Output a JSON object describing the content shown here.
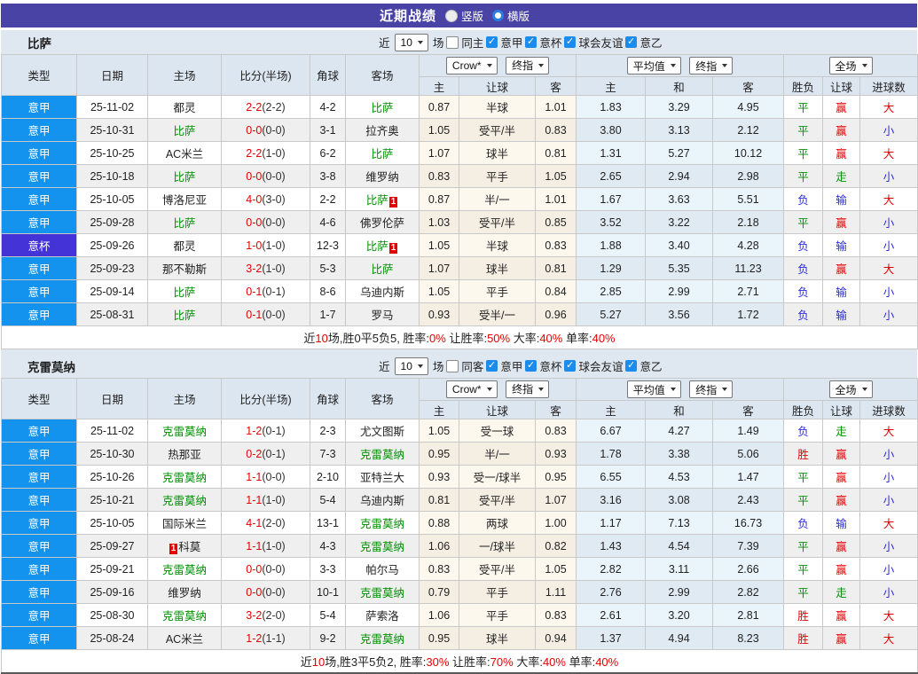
{
  "titlebar": {
    "title": "近期战绩",
    "radios": [
      {
        "label": "竖版",
        "selected": false
      },
      {
        "label": "横版",
        "selected": true
      }
    ]
  },
  "labels": {
    "near": "近",
    "games": "场",
    "leagues": [
      "意甲",
      "意杯",
      "球会友谊",
      "意乙"
    ]
  },
  "selects": {
    "crown": "Crow*",
    "final": "终指",
    "average": "平均值",
    "final2": "终指",
    "full": "全场"
  },
  "columns": {
    "type": "类型",
    "date": "日期",
    "home": "主场",
    "score": "比分(半场)",
    "corner": "角球",
    "away": "客场",
    "odds_home": "主",
    "odds_handicap": "让球",
    "odds_away": "客",
    "avg_home": "主",
    "avg_draw": "和",
    "avg_away": "客",
    "res_wdl": "胜负",
    "res_handicap": "让球",
    "res_goals": "进球数"
  },
  "row_fields": [
    "league",
    "league_class(a=意甲,b=意杯)",
    "date",
    "home[name,isSelf,badge,badgePos]",
    "score[full,half]",
    "corner",
    "away[name,isSelf,badge,badgePos]",
    "crown_home",
    "crown_handicap",
    "crown_away",
    "avg_home",
    "avg_draw",
    "avg_away",
    "result_wdl[text,color]",
    "result_handicap[text,color]",
    "result_goals[text,color]"
  ],
  "tables": [
    {
      "team": "比萨",
      "count": "10",
      "same_side": "同主",
      "same_checked": false,
      "rows": [
        [
          "意甲",
          "a",
          "25-11-02",
          [
            "都灵",
            0,
            "",
            ""
          ],
          [
            "2-2",
            "(2-2)"
          ],
          "4-2",
          [
            "比萨",
            1,
            "",
            ""
          ],
          "0.87",
          "半球",
          "1.01",
          "1.83",
          "3.29",
          "4.95",
          [
            "平",
            "g"
          ],
          [
            "赢",
            "r"
          ],
          [
            "大",
            "r"
          ]
        ],
        [
          "意甲",
          "a",
          "25-10-31",
          [
            "比萨",
            1,
            "",
            ""
          ],
          [
            "0-0",
            "(0-0)"
          ],
          "3-1",
          [
            "拉齐奥",
            0,
            "",
            ""
          ],
          "1.05",
          "受平/半",
          "0.83",
          "3.80",
          "3.13",
          "2.12",
          [
            "平",
            "g"
          ],
          [
            "赢",
            "r"
          ],
          [
            "小",
            "b"
          ]
        ],
        [
          "意甲",
          "a",
          "25-10-25",
          [
            "AC米兰",
            0,
            "",
            ""
          ],
          [
            "2-2",
            "(1-0)"
          ],
          "6-2",
          [
            "比萨",
            1,
            "",
            ""
          ],
          "1.07",
          "球半",
          "0.81",
          "1.31",
          "5.27",
          "10.12",
          [
            "平",
            "g"
          ],
          [
            "赢",
            "r"
          ],
          [
            "大",
            "r"
          ]
        ],
        [
          "意甲",
          "a",
          "25-10-18",
          [
            "比萨",
            1,
            "",
            ""
          ],
          [
            "0-0",
            "(0-0)"
          ],
          "3-8",
          [
            "维罗纳",
            0,
            "",
            ""
          ],
          "0.83",
          "平手",
          "1.05",
          "2.65",
          "2.94",
          "2.98",
          [
            "平",
            "g"
          ],
          [
            "走",
            "g"
          ],
          [
            "小",
            "b"
          ]
        ],
        [
          "意甲",
          "a",
          "25-10-05",
          [
            "博洛尼亚",
            0,
            "",
            ""
          ],
          [
            "4-0",
            "(3-0)"
          ],
          "2-2",
          [
            "比萨",
            1,
            "1",
            "a"
          ],
          "0.87",
          "半/一",
          "1.01",
          "1.67",
          "3.63",
          "5.51",
          [
            "负",
            "b"
          ],
          [
            "输",
            "b"
          ],
          [
            "大",
            "r"
          ]
        ],
        [
          "意甲",
          "a",
          "25-09-28",
          [
            "比萨",
            1,
            "",
            ""
          ],
          [
            "0-0",
            "(0-0)"
          ],
          "4-6",
          [
            "佛罗伦萨",
            0,
            "",
            ""
          ],
          "1.03",
          "受平/半",
          "0.85",
          "3.52",
          "3.22",
          "2.18",
          [
            "平",
            "g"
          ],
          [
            "赢",
            "r"
          ],
          [
            "小",
            "b"
          ]
        ],
        [
          "意杯",
          "b",
          "25-09-26",
          [
            "都灵",
            0,
            "",
            ""
          ],
          [
            "1-0",
            "(1-0)"
          ],
          "12-3",
          [
            "比萨",
            1,
            "1",
            "a"
          ],
          "1.05",
          "半球",
          "0.83",
          "1.88",
          "3.40",
          "4.28",
          [
            "负",
            "b"
          ],
          [
            "输",
            "b"
          ],
          [
            "小",
            "b"
          ]
        ],
        [
          "意甲",
          "a",
          "25-09-23",
          [
            "那不勒斯",
            0,
            "",
            ""
          ],
          [
            "3-2",
            "(1-0)"
          ],
          "5-3",
          [
            "比萨",
            1,
            "",
            ""
          ],
          "1.07",
          "球半",
          "0.81",
          "1.29",
          "5.35",
          "11.23",
          [
            "负",
            "b"
          ],
          [
            "赢",
            "r"
          ],
          [
            "大",
            "r"
          ]
        ],
        [
          "意甲",
          "a",
          "25-09-14",
          [
            "比萨",
            1,
            "",
            ""
          ],
          [
            "0-1",
            "(0-1)"
          ],
          "8-6",
          [
            "乌迪内斯",
            0,
            "",
            ""
          ],
          "1.05",
          "平手",
          "0.84",
          "2.85",
          "2.99",
          "2.71",
          [
            "负",
            "b"
          ],
          [
            "输",
            "b"
          ],
          [
            "小",
            "b"
          ]
        ],
        [
          "意甲",
          "a",
          "25-08-31",
          [
            "比萨",
            1,
            "",
            ""
          ],
          [
            "0-1",
            "(0-0)"
          ],
          "1-7",
          [
            "罗马",
            0,
            "",
            ""
          ],
          "0.93",
          "受半/一",
          "0.96",
          "5.27",
          "3.56",
          "1.72",
          [
            "负",
            "b"
          ],
          [
            "输",
            "b"
          ],
          [
            "小",
            "b"
          ]
        ]
      ],
      "summary": [
        [
          "近",
          0
        ],
        [
          "10",
          1
        ],
        [
          "场,胜0平5负5, 胜率:",
          0
        ],
        [
          "0%",
          1
        ],
        [
          " 让胜率:",
          0
        ],
        [
          "50%",
          1
        ],
        [
          " 大率:",
          0
        ],
        [
          "40%",
          1
        ],
        [
          " 单率:",
          0
        ],
        [
          "40%",
          1
        ]
      ]
    },
    {
      "team": "克雷莫纳",
      "count": "10",
      "same_side": "同客",
      "same_checked": false,
      "rows": [
        [
          "意甲",
          "a",
          "25-11-02",
          [
            "克雷莫纳",
            1,
            "",
            ""
          ],
          [
            "1-2",
            "(0-1)"
          ],
          "2-3",
          [
            "尤文图斯",
            0,
            "",
            ""
          ],
          "1.05",
          "受一球",
          "0.83",
          "6.67",
          "4.27",
          "1.49",
          [
            "负",
            "b"
          ],
          [
            "走",
            "g"
          ],
          [
            "大",
            "r"
          ]
        ],
        [
          "意甲",
          "a",
          "25-10-30",
          [
            "热那亚",
            0,
            "",
            ""
          ],
          [
            "0-2",
            "(0-1)"
          ],
          "7-3",
          [
            "克雷莫纳",
            1,
            "",
            ""
          ],
          "0.95",
          "半/一",
          "0.93",
          "1.78",
          "3.38",
          "5.06",
          [
            "胜",
            "r"
          ],
          [
            "赢",
            "r"
          ],
          [
            "小",
            "b"
          ]
        ],
        [
          "意甲",
          "a",
          "25-10-26",
          [
            "克雷莫纳",
            1,
            "",
            ""
          ],
          [
            "1-1",
            "(0-0)"
          ],
          "2-10",
          [
            "亚特兰大",
            0,
            "",
            ""
          ],
          "0.93",
          "受一/球半",
          "0.95",
          "6.55",
          "4.53",
          "1.47",
          [
            "平",
            "g"
          ],
          [
            "赢",
            "r"
          ],
          [
            "小",
            "b"
          ]
        ],
        [
          "意甲",
          "a",
          "25-10-21",
          [
            "克雷莫纳",
            1,
            "",
            ""
          ],
          [
            "1-1",
            "(1-0)"
          ],
          "5-4",
          [
            "乌迪内斯",
            0,
            "",
            ""
          ],
          "0.81",
          "受平/半",
          "1.07",
          "3.16",
          "3.08",
          "2.43",
          [
            "平",
            "g"
          ],
          [
            "赢",
            "r"
          ],
          [
            "小",
            "b"
          ]
        ],
        [
          "意甲",
          "a",
          "25-10-05",
          [
            "国际米兰",
            0,
            "",
            ""
          ],
          [
            "4-1",
            "(2-0)"
          ],
          "13-1",
          [
            "克雷莫纳",
            1,
            "",
            ""
          ],
          "0.88",
          "两球",
          "1.00",
          "1.17",
          "7.13",
          "16.73",
          [
            "负",
            "b"
          ],
          [
            "输",
            "b"
          ],
          [
            "大",
            "r"
          ]
        ],
        [
          "意甲",
          "a",
          "25-09-27",
          [
            "科莫",
            0,
            "1",
            "b"
          ],
          [
            "1-1",
            "(1-0)"
          ],
          "4-3",
          [
            "克雷莫纳",
            1,
            "",
            ""
          ],
          "1.06",
          "一/球半",
          "0.82",
          "1.43",
          "4.54",
          "7.39",
          [
            "平",
            "g"
          ],
          [
            "赢",
            "r"
          ],
          [
            "小",
            "b"
          ]
        ],
        [
          "意甲",
          "a",
          "25-09-21",
          [
            "克雷莫纳",
            1,
            "",
            ""
          ],
          [
            "0-0",
            "(0-0)"
          ],
          "3-3",
          [
            "帕尔马",
            0,
            "",
            ""
          ],
          "0.83",
          "受平/半",
          "1.05",
          "2.82",
          "3.11",
          "2.66",
          [
            "平",
            "g"
          ],
          [
            "赢",
            "r"
          ],
          [
            "小",
            "b"
          ]
        ],
        [
          "意甲",
          "a",
          "25-09-16",
          [
            "维罗纳",
            0,
            "",
            ""
          ],
          [
            "0-0",
            "(0-0)"
          ],
          "10-1",
          [
            "克雷莫纳",
            1,
            "",
            ""
          ],
          "0.79",
          "平手",
          "1.11",
          "2.76",
          "2.99",
          "2.82",
          [
            "平",
            "g"
          ],
          [
            "走",
            "g"
          ],
          [
            "小",
            "b"
          ]
        ],
        [
          "意甲",
          "a",
          "25-08-30",
          [
            "克雷莫纳",
            1,
            "",
            ""
          ],
          [
            "3-2",
            "(2-0)"
          ],
          "5-4",
          [
            "萨索洛",
            0,
            "",
            ""
          ],
          "1.06",
          "平手",
          "0.83",
          "2.61",
          "3.20",
          "2.81",
          [
            "胜",
            "r"
          ],
          [
            "赢",
            "r"
          ],
          [
            "大",
            "r"
          ]
        ],
        [
          "意甲",
          "a",
          "25-08-24",
          [
            "AC米兰",
            0,
            "",
            ""
          ],
          [
            "1-2",
            "(1-1)"
          ],
          "9-2",
          [
            "克雷莫纳",
            1,
            "",
            ""
          ],
          "0.95",
          "球半",
          "0.94",
          "1.37",
          "4.94",
          "8.23",
          [
            "胜",
            "r"
          ],
          [
            "赢",
            "r"
          ],
          [
            "大",
            "r"
          ]
        ]
      ],
      "summary": [
        [
          "近",
          0
        ],
        [
          "10",
          1
        ],
        [
          "场,胜3平5负2, 胜率:",
          0
        ],
        [
          "30%",
          1
        ],
        [
          " 让胜率:",
          0
        ],
        [
          "70%",
          1
        ],
        [
          " 大率:",
          0
        ],
        [
          "40%",
          1
        ],
        [
          " 单率:",
          0
        ],
        [
          "40%",
          1
        ]
      ]
    }
  ],
  "colors": {
    "topbar_bg": "#4a43a6",
    "band_bg": "#dfe7f1",
    "header_cell_bg": "#dce6f1",
    "serie_a_bg": "#1493ee",
    "coppa_bg": "#4433d6",
    "team_green": "#009000",
    "score_red": "#e60000",
    "result_red": "#e60000",
    "result_green": "#009000",
    "result_blue": "#2b2bd5",
    "badge_bg": "#e60000",
    "check_blue": "#1b8ceb",
    "odds_bg": "#fdf8ee",
    "odds_alt_bg": "#f4eee3",
    "avg_bg": "#e9f4fb",
    "avg_alt_bg": "#e0eaf3",
    "alt_row_bg": "#efefef"
  }
}
